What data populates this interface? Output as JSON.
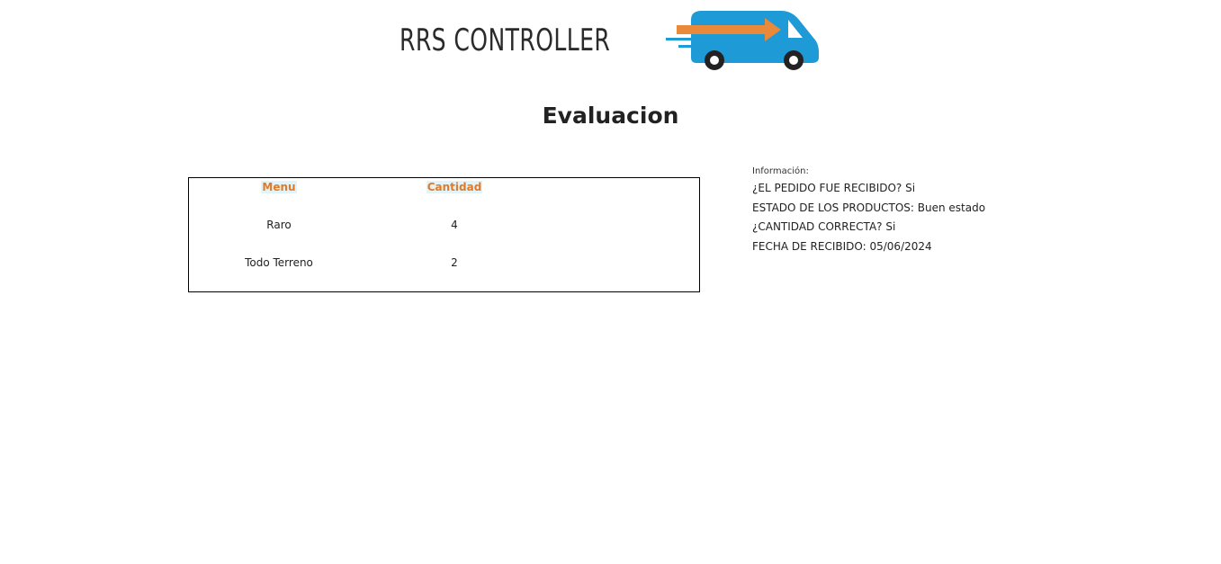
{
  "logo": {
    "text": "RRS CONTROLLER",
    "colors": {
      "truck": "#1e9ad6",
      "arrow": "#e88a3a",
      "wheels": "#222222"
    }
  },
  "page": {
    "title": "Evaluacion"
  },
  "table": {
    "columns": [
      "Menu",
      "Cantidad"
    ],
    "rows": [
      {
        "menu": "Raro",
        "cantidad": "4"
      },
      {
        "menu": "Todo Terreno",
        "cantidad": "2"
      }
    ],
    "header_color": "#e07a2a",
    "header_bg": "#e4f4f6"
  },
  "info": {
    "label": "Información:",
    "lines": [
      "¿EL PEDIDO FUE RECIBIDO? Si",
      "ESTADO DE LOS PRODUCTOS: Buen estado",
      "¿CANTIDAD CORRECTA? Si",
      "FECHA DE RECIBIDO: 05/06/2024"
    ]
  }
}
